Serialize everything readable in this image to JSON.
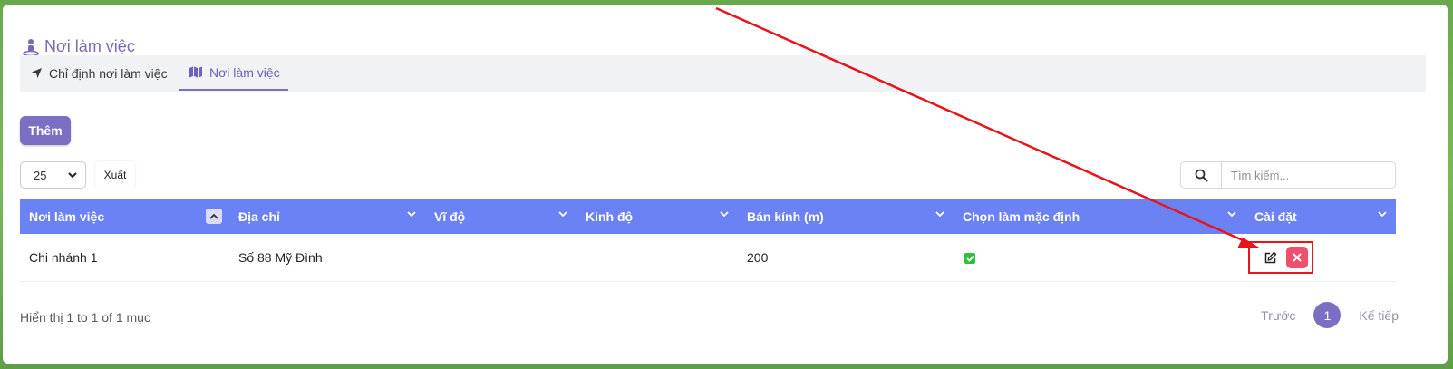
{
  "page": {
    "title": "Nơi làm việc"
  },
  "tabs": [
    {
      "label": "Chỉ định nơi làm việc",
      "icon": "location-arrow-icon",
      "active": false
    },
    {
      "label": "Nơi làm việc",
      "icon": "map-icon",
      "active": true
    }
  ],
  "toolbar": {
    "add_label": "Thêm",
    "page_length": "25",
    "export_label": "Xuất",
    "search_placeholder": "Tìm kiếm..."
  },
  "table": {
    "columns": [
      "Nơi làm việc",
      "Địa chỉ",
      "Vĩ độ",
      "Kinh độ",
      "Bán kính (m)",
      "Chọn làm mặc định",
      "Cài đặt"
    ],
    "rows": [
      {
        "name": "Chi nhánh 1",
        "address": "Số 88 Mỹ Đình",
        "latitude": "",
        "longitude": "",
        "radius": "200",
        "is_default": true
      }
    ]
  },
  "footer": {
    "info": "Hiển thị 1 to 1 of 1 mục",
    "prev_label": "Trước",
    "current_page": "1",
    "next_label": "Kế tiếp"
  },
  "colors": {
    "accent": "#7b6fc4",
    "table_header": "#6b82f5",
    "delete": "#f0506e",
    "check": "#2fbf3f",
    "annotation": "#e8141a"
  }
}
